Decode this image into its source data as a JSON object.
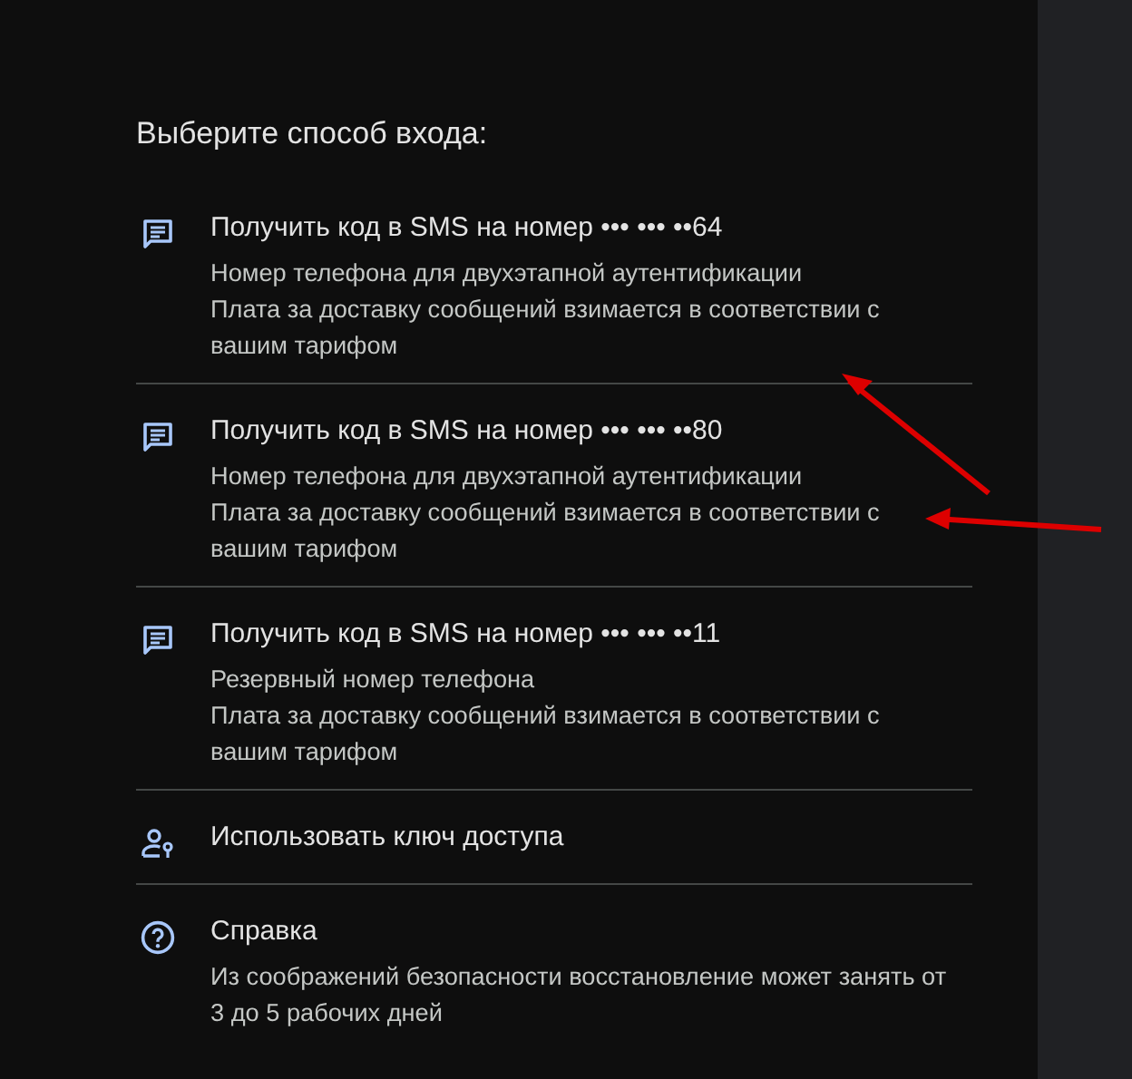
{
  "heading": "Выберите способ входа:",
  "options": [
    {
      "kind": "sms",
      "title": "Получить код в SMS на номер ••• ••• ••64",
      "details": [
        "Номер телефона для двухэтапной аутентификации",
        "Плата за доставку сообщений взимается в соответствии с вашим тарифом"
      ]
    },
    {
      "kind": "sms",
      "title": "Получить код в SMS на номер ••• ••• ••80",
      "details": [
        "Номер телефона для двухэтапной аутентификации",
        "Плата за доставку сообщений взимается в соответствии с вашим тарифом"
      ]
    },
    {
      "kind": "sms",
      "title": "Получить код в SMS на номер ••• ••• ••11",
      "details": [
        "Резервный номер телефона",
        "Плата за доставку сообщений взимается в соответствии с вашим тарифом"
      ]
    },
    {
      "kind": "passkey",
      "title": "Использовать ключ доступа"
    },
    {
      "kind": "help",
      "title": "Справка",
      "details": [
        "Из соображений безопасности восстановление может занять от 3 до 5 рабочих дней"
      ]
    }
  ]
}
